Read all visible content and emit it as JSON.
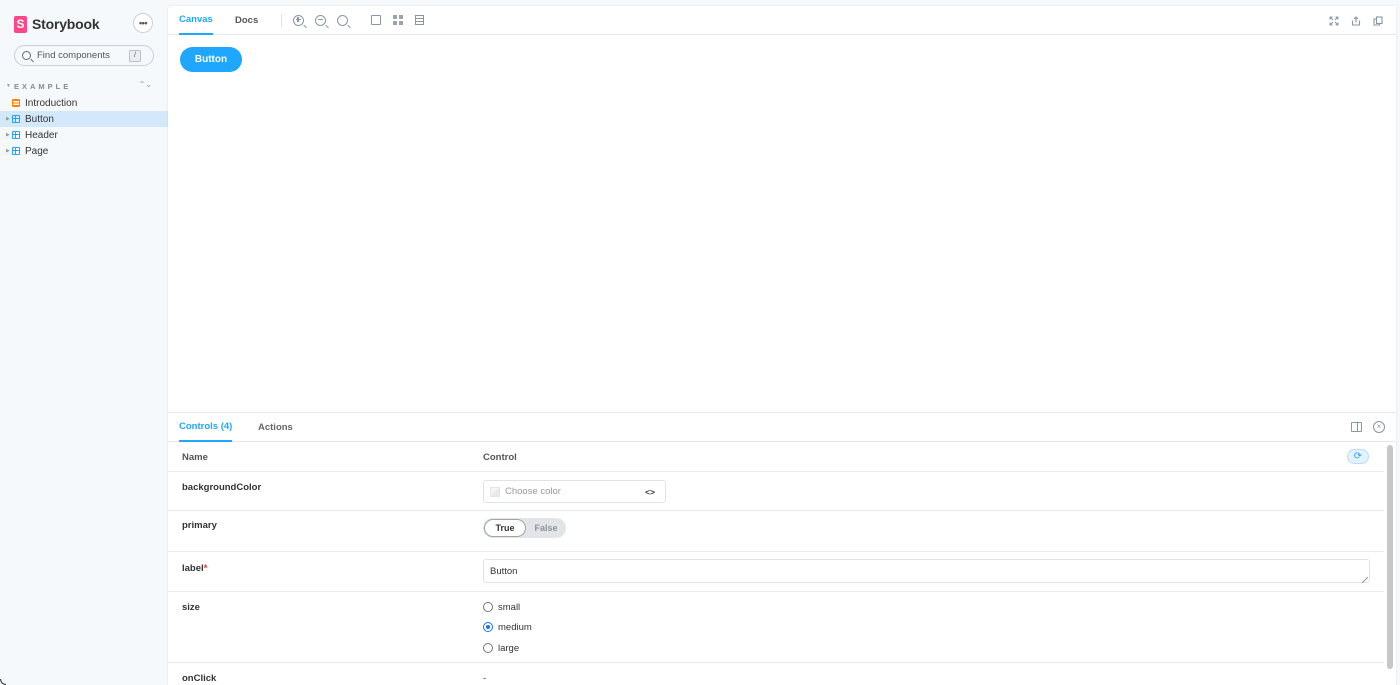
{
  "sidebar": {
    "brand": {
      "mark": "S",
      "name": "Storybook"
    },
    "menu_label": "•••",
    "search": {
      "placeholder": "Find components",
      "shortcut": "/"
    },
    "group": {
      "label": "EXAMPLE",
      "caret": "▼",
      "toggle": "⌃⌄"
    },
    "items": [
      {
        "label": "Introduction",
        "type": "docs",
        "active": false
      },
      {
        "label": "Button",
        "type": "component",
        "active": true,
        "caret": "▶"
      },
      {
        "label": "Header",
        "type": "component",
        "active": false,
        "caret": "▶"
      },
      {
        "label": "Page",
        "type": "component",
        "active": false,
        "caret": "▶"
      }
    ]
  },
  "toolbar": {
    "tabs": [
      {
        "label": "Canvas",
        "active": true
      },
      {
        "label": "Docs",
        "active": false
      }
    ],
    "icons": [
      "zoom-in-icon",
      "zoom-out-icon",
      "zoom-reset-icon",
      "background-icon",
      "grid-icon",
      "outline-icon"
    ],
    "right_icons": [
      "fullscreen-icon",
      "share-icon",
      "copy-link-icon"
    ]
  },
  "canvas": {
    "button_label": "Button"
  },
  "addons": {
    "tabs": [
      {
        "label": "Controls (4)",
        "active": true
      },
      {
        "label": "Actions",
        "active": false
      }
    ],
    "table": {
      "headers": {
        "name": "Name",
        "control": "Control"
      },
      "rows": {
        "backgroundColor": {
          "name": "backgroundColor",
          "placeholder": "Choose color",
          "code_icon": "<>"
        },
        "primary": {
          "name": "primary",
          "true_label": "True",
          "false_label": "False",
          "value": true
        },
        "label": {
          "name": "label",
          "required_mark": "*",
          "value": "Button"
        },
        "size": {
          "name": "size",
          "options": [
            "small",
            "medium",
            "large"
          ],
          "selected": "medium"
        },
        "onClick": {
          "name": "onClick",
          "value": "-"
        }
      }
    }
  },
  "colors": {
    "accent": "#1EA7FD",
    "brand": "#FF4785",
    "sidebar_bg": "#F6F9FC",
    "active_item": "#D3E9FB"
  }
}
